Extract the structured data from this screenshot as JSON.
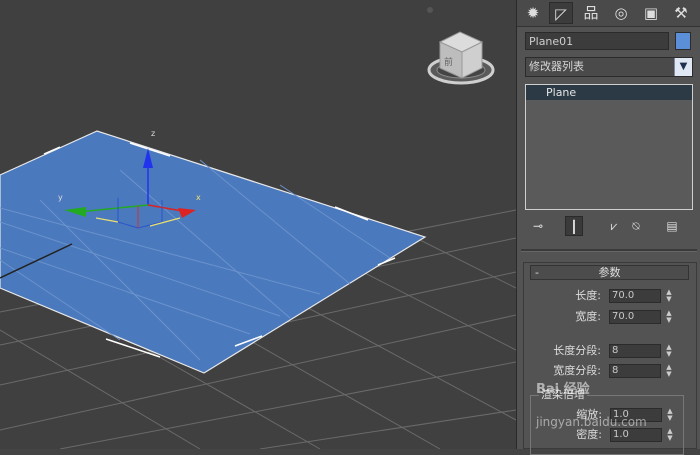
{
  "viewport": {
    "gizmo_labels": {
      "z": "z",
      "x": "x",
      "y": "y"
    },
    "viewcube_face_label": "前"
  },
  "command_panel": {
    "tabs": [
      {
        "icon": "create-icon",
        "glyph": "✹"
      },
      {
        "icon": "modify-icon",
        "glyph": "◸"
      },
      {
        "icon": "hierarchy-icon",
        "glyph": "品"
      },
      {
        "icon": "motion-icon",
        "glyph": "◎"
      },
      {
        "icon": "display-icon",
        "glyph": "▣"
      },
      {
        "icon": "utilities-icon",
        "glyph": "⚒"
      }
    ],
    "object_name": "Plane01",
    "object_color": "#5b8fd8",
    "modifier_list": "修改器列表",
    "stack_items": [
      "Plane"
    ],
    "stack_buttons": [
      "pin-stack-icon",
      "show-end-result-icon",
      "make-unique-icon",
      "remove-modifier-icon",
      "configure-sets-icon"
    ],
    "rollout": {
      "collapse_symbol": "-",
      "title": "参数",
      "params": [
        {
          "label": "长度:",
          "value": "70.0"
        },
        {
          "label": "宽度:",
          "value": "70.0"
        },
        {
          "label": "长度分段:",
          "value": "8"
        },
        {
          "label": "宽度分段:",
          "value": "8"
        }
      ],
      "render_group": {
        "title": "渲染倍增",
        "params": [
          {
            "label": "缩放:",
            "value": "1.0"
          },
          {
            "label": "密度:",
            "value": "1.0"
          }
        ]
      }
    }
  },
  "watermark": {
    "line1": "Bai 经验",
    "line2": "jingyan.baidu.com"
  }
}
